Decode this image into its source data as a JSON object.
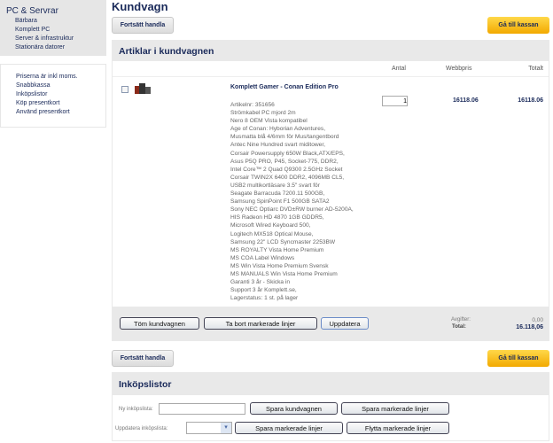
{
  "sidebar": {
    "heading": "PC & Servrar",
    "items": [
      "Bärbara",
      "Komplett PC",
      "Server & infrastruktur",
      "Stationära datorer"
    ],
    "links": [
      "Priserna är inkl moms.",
      "Snabbkassa",
      "Inköpslistor",
      "Köp presentkort",
      "Använd presentkort"
    ]
  },
  "page": {
    "title": "Kundvagn",
    "continue_label": "Fortsätt handla",
    "checkout_label": "Gå till kassan"
  },
  "cart": {
    "heading": "Artiklar i kundvagnen",
    "columns": {
      "qty": "Antal",
      "price": "Webbpris",
      "total": "Totalt"
    },
    "item": {
      "name": "Komplett Gamer - Conan Edition Pro",
      "qty": "1",
      "price": "16118.06",
      "total": "16118.06",
      "details": [
        "Artikelnr: 351656",
        "Strömkabel PC mjord 2m",
        "Nero 8 OEM Vista kompatibel",
        "Age of Conan: Hyborian Adventures,",
        "Musmatta blå 4/6mm för Mus/tangentbord",
        "Antec Nine Hundred svart miditower,",
        "Corsair Powersupply 650W Black,ATX/EPS,",
        "Asus P5Q PRO, P45, Socket-775, DDR2,",
        "Intel Core™ 2 Quad Q9300 2.5GHz Socket",
        "Corsair TWIN2X 6400 DDR2, 4096MB CL5,",
        "USB2 multikortläsare 3.5\" svart för",
        "Seagate Barracuda 7200.11 500GB,",
        "Samsung SpinPoint F1 500GB SATA2",
        "Sony NEC Optiarc DVD±RW burner AD-5200A,",
        "HIS Radeon HD 4870 1GB GDDR5,",
        "Microsoft Wired Keyboard 500,",
        "Logitech MX518 Optical Mouse,",
        "Samsung 22\" LCD Syncmaster 2253BW",
        "MS ROYALTY Vista Home Premium",
        "MS COA Label Windows",
        "MS Win Vista Home Premium Svensk",
        "MS MANUALS Win Vista Home Premium",
        "Garanti 3 år - Skicka in",
        "Support 3 år Komplett.se,",
        "Lagerstatus: 1 st. på lager"
      ]
    },
    "buttons": {
      "empty": "Töm kundvagnen",
      "remove": "Ta bort markerade linjer",
      "update": "Uppdatera"
    },
    "fees_label": "Avgifter:",
    "fees": "0,00",
    "total_label": "Total:",
    "total": "16.118,06"
  },
  "lists": {
    "heading": "Inköpslistor",
    "new_label": "Ny inköpslista:",
    "update_label": "Uppdatera inköpslista:",
    "save_cart": "Spara kundvagnen",
    "save_selected": "Spara markerade linjer",
    "save_selected2": "Spara markerade linjer",
    "move_selected": "Flytta markerade linjer"
  },
  "colors": {
    "accent": "#f2a900",
    "text": "#1a2a5a",
    "panel": "#e9e9e9"
  }
}
